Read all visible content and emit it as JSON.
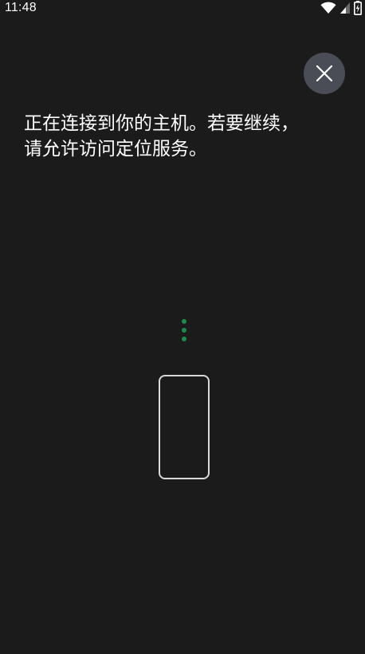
{
  "status_bar": {
    "time": "11:48",
    "icons": [
      "wifi-icon",
      "cellular-signal-icon",
      "battery-charging-icon"
    ]
  },
  "dialog": {
    "close_icon": "close-icon",
    "message_line1": "正在连接到你的主机。若要继续，",
    "message_line2": "请允许访问定位服务。"
  },
  "illustration": {
    "dots_color": "#1e8a4c",
    "phone_icon": "phone-outline-icon"
  },
  "colors": {
    "background": "#1b1b1b",
    "close_button_bg": "#4a4d55",
    "accent": "#1e8a4c"
  }
}
